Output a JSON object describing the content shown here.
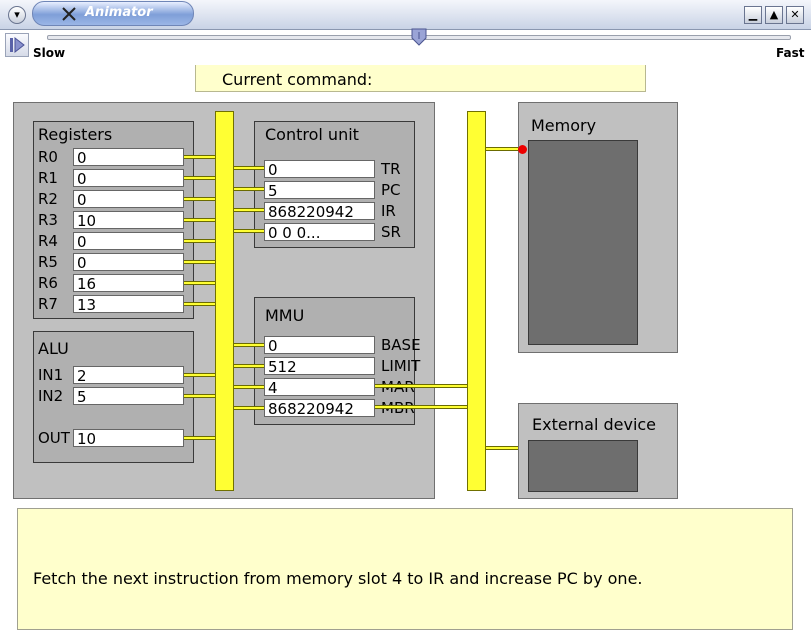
{
  "window": {
    "title": "Animator",
    "menu_glyph": "▾",
    "min_glyph": "▁",
    "max_glyph": "▲",
    "close_glyph": "✕"
  },
  "toolbar": {
    "speed_slow": "Slow",
    "speed_fast": "Fast",
    "speed_fraction": 0.5
  },
  "current_command": {
    "label": "Current command:",
    "value": ""
  },
  "registers": {
    "title": "Registers",
    "items": [
      {
        "name": "R0",
        "value": "0"
      },
      {
        "name": "R1",
        "value": "0"
      },
      {
        "name": "R2",
        "value": "0"
      },
      {
        "name": "R3",
        "value": "10"
      },
      {
        "name": "R4",
        "value": "0"
      },
      {
        "name": "R5",
        "value": "0"
      },
      {
        "name": "R6",
        "value": "16"
      },
      {
        "name": "R7",
        "value": "13"
      }
    ]
  },
  "alu": {
    "title": "ALU",
    "in1_label": "IN1",
    "in1": "2",
    "in2_label": "IN2",
    "in2": "5",
    "out_label": "OUT",
    "out": "10"
  },
  "control_unit": {
    "title": "Control unit",
    "items": [
      {
        "name": "TR",
        "value": "0"
      },
      {
        "name": "PC",
        "value": "5"
      },
      {
        "name": "IR",
        "value": "868220942"
      },
      {
        "name": "SR",
        "value": "0   0   0..."
      }
    ]
  },
  "mmu": {
    "title": "MMU",
    "items": [
      {
        "name": "BASE",
        "value": "0"
      },
      {
        "name": "LIMIT",
        "value": "512"
      },
      {
        "name": "MAR",
        "value": "4"
      },
      {
        "name": "MBR",
        "value": "868220942"
      }
    ]
  },
  "memory": {
    "title": "Memory"
  },
  "external_device": {
    "title": "External device"
  },
  "message": "Fetch the next instruction from memory slot 4 to IR and increase PC by one.",
  "colors": {
    "bus": "#ffff33",
    "message_bg": "#ffffcc",
    "panel": "#c0c0c0",
    "inner_panel": "#6e6e6e",
    "signal_dot": "#ee0000"
  }
}
